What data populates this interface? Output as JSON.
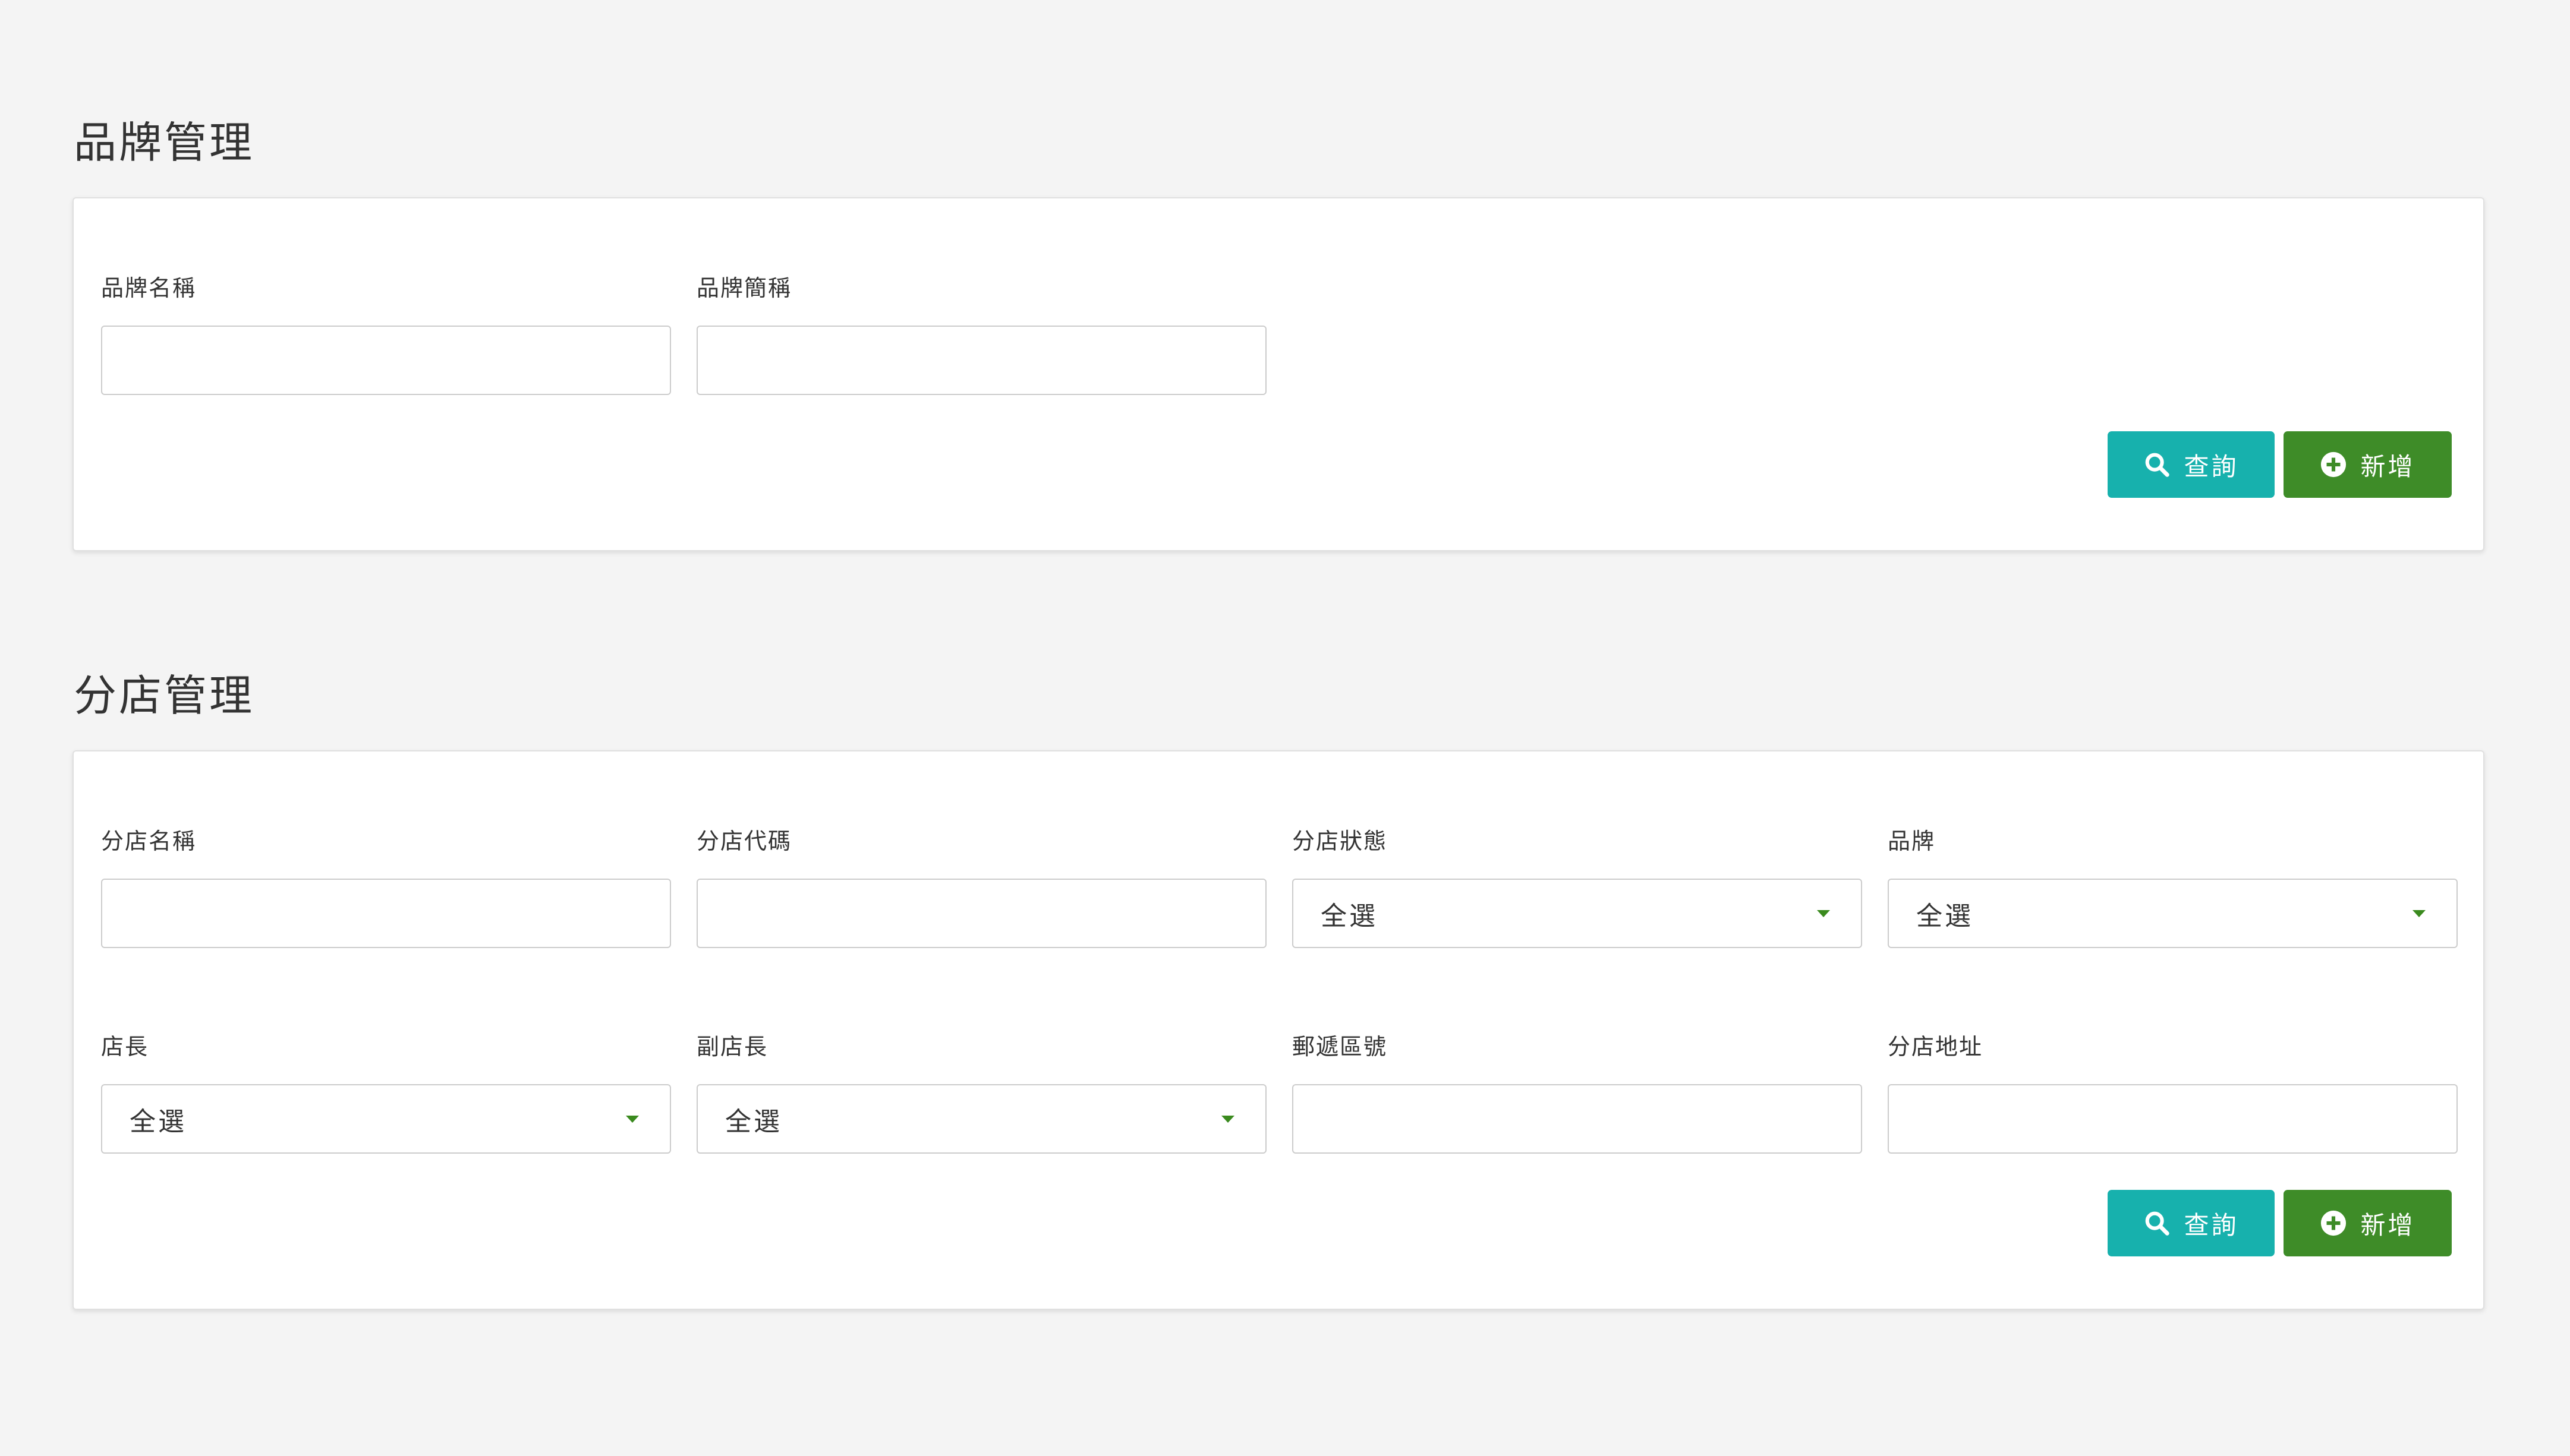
{
  "brand_section": {
    "title": "品牌管理",
    "fields": [
      {
        "label": "品牌名稱",
        "value": "",
        "placeholder": ""
      },
      {
        "label": "品牌簡稱",
        "value": "",
        "placeholder": ""
      }
    ],
    "query_label": "查詢",
    "add_label": "新增"
  },
  "branch_section": {
    "title": "分店管理",
    "fields": [
      {
        "label": "分店名稱",
        "value": "",
        "placeholder": ""
      },
      {
        "label": "分店代碼",
        "value": "",
        "placeholder": ""
      },
      {
        "label": "分店狀態",
        "selected": "全選"
      },
      {
        "label": "品牌",
        "selected": "全選"
      },
      {
        "label": "店長",
        "selected": "全選"
      },
      {
        "label": "副店長",
        "selected": "全選"
      },
      {
        "label": "郵遞區號",
        "value": "",
        "placeholder": ""
      },
      {
        "label": "分店地址",
        "value": "",
        "placeholder": ""
      }
    ],
    "query_label": "查詢",
    "add_label": "新增"
  },
  "icons": {
    "query": "search-icon",
    "add": "plus-circle-icon",
    "dropdown": "caret-down-icon"
  },
  "colors": {
    "query_button": "#17b1ad",
    "add_button": "#3e8c28",
    "dropdown_caret": "#3a8a1e",
    "background": "#f4f4f4"
  }
}
